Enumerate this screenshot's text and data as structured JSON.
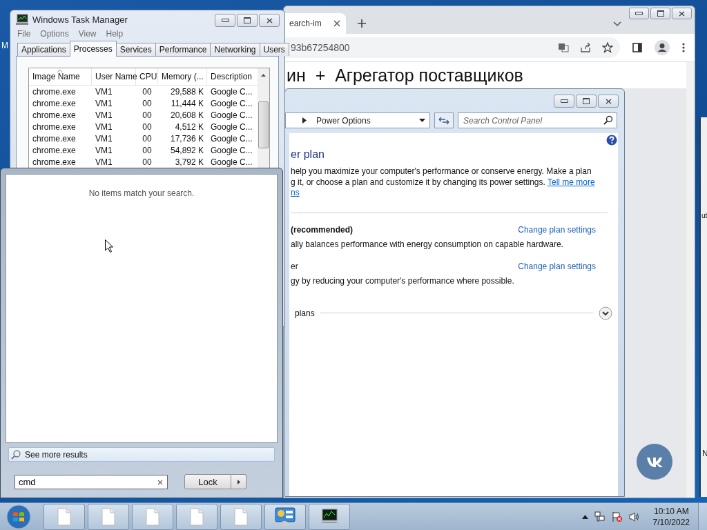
{
  "desktop": {
    "icon_label": "M"
  },
  "browser": {
    "tab_title": "earch-im",
    "address": "93b67254800",
    "heading": "ин  +  Агрегатор поставщиков"
  },
  "back_window": {
    "texts": [
      "ut",
      "N"
    ]
  },
  "control_panel": {
    "breadcrumb": "Power Options",
    "search": {
      "placeholder": "Search Control Panel"
    },
    "heading": "er plan",
    "intro": {
      "lines": [
        "help you maximize your computer's performance or conserve energy. Make a plan",
        "g it, or choose a plan and customize it by changing its power settings."
      ],
      "link": "Tell me more",
      "link_continued": "ns"
    },
    "plans": [
      {
        "name": "(recommended)",
        "selected": true,
        "action": "Change plan settings",
        "description": "ally balances performance with energy consumption on capable hardware."
      },
      {
        "name": "er",
        "selected": false,
        "action": "Change plan settings",
        "description": "gy by reducing your computer's performance where possible."
      }
    ],
    "more_plans": {
      "label": "plans",
      "expanded": false
    }
  },
  "task_manager": {
    "title": "Windows Task Manager",
    "menu": [
      "File",
      "Options",
      "View",
      "Help"
    ],
    "tabs": [
      {
        "label": "Applications",
        "selected": false
      },
      {
        "label": "Processes",
        "selected": true
      },
      {
        "label": "Services",
        "selected": false
      },
      {
        "label": "Performance",
        "selected": false
      },
      {
        "label": "Networking",
        "selected": false
      },
      {
        "label": "Users",
        "selected": false
      }
    ],
    "columns": [
      {
        "label": "Image Name",
        "sorted": true
      },
      {
        "label": "User Name",
        "sorted": false
      },
      {
        "label": "CPU",
        "sorted": false
      },
      {
        "label": "Memory (...",
        "sorted": false
      },
      {
        "label": "Description",
        "sorted": false
      }
    ],
    "rows": [
      [
        "chrome.exe",
        "VM1",
        "00",
        "29,588 K",
        "Google C..."
      ],
      [
        "chrome.exe",
        "VM1",
        "00",
        "11,444 K",
        "Google C..."
      ],
      [
        "chrome.exe",
        "VM1",
        "00",
        "20,608 K",
        "Google C..."
      ],
      [
        "chrome.exe",
        "VM1",
        "00",
        "4,512 K",
        "Google C..."
      ],
      [
        "chrome.exe",
        "VM1",
        "00",
        "17,736 K",
        "Google C..."
      ],
      [
        "chrome.exe",
        "VM1",
        "00",
        "54,892 K",
        "Google C..."
      ],
      [
        "chrome.exe",
        "VM1",
        "00",
        "3,792 K",
        "Google C..."
      ]
    ]
  },
  "start_menu": {
    "message": "No items match your search.",
    "see_more": "See more results",
    "search_value": "cmd",
    "power_button": "Lock"
  },
  "taskbar": {
    "items": [
      {
        "kind": "document"
      },
      {
        "kind": "document"
      },
      {
        "kind": "document"
      },
      {
        "kind": "document"
      },
      {
        "kind": "document"
      },
      {
        "kind": "control-panel"
      },
      {
        "kind": "task-manager"
      }
    ],
    "time": "10:10 AM",
    "date": "7/10/2022"
  }
}
